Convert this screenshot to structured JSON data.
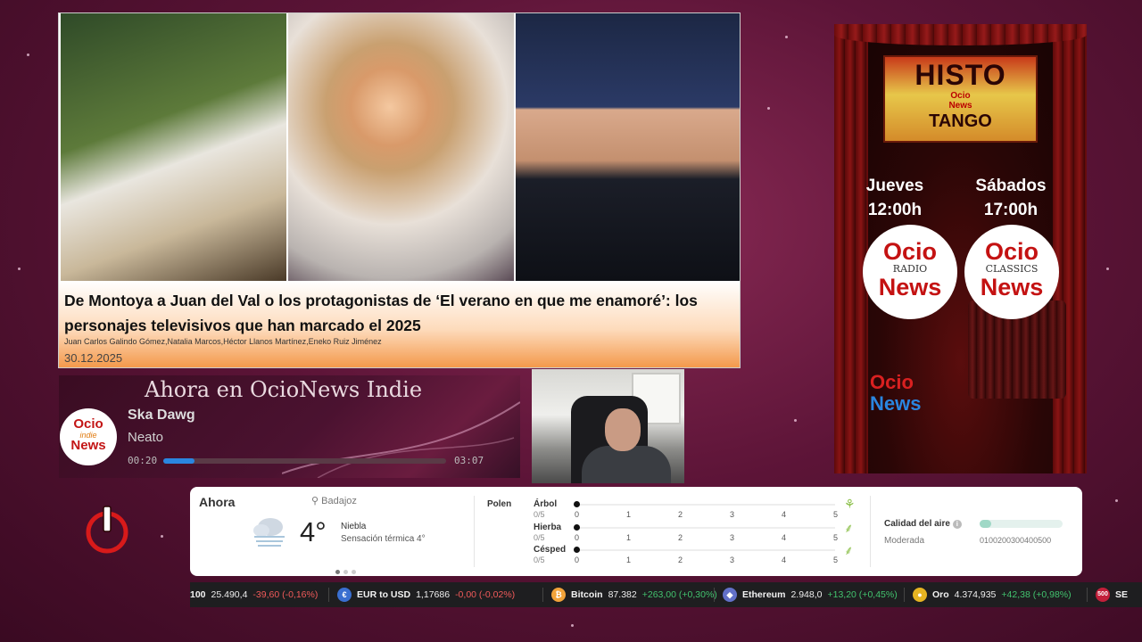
{
  "hero": {
    "title": "De Montoya a Juan del Val o los protagonistas de ‘El verano en que me enamoré’: los personajes televisivos que han marcado el 2025",
    "authors": "Juan Carlos Galindo Gómez,Natalia Marcos,Héctor Llanos Martínez,Eneko Ruiz Jiménez",
    "date": "30.12.2025"
  },
  "radio": {
    "heading": "Ahora en OcioNews Indie",
    "logo_top": "Ocio",
    "logo_mid": "indie",
    "logo_bottom": "News",
    "song": "Ska Dawg",
    "artist": "Neato",
    "elapsed": "00:20",
    "duration": "03:07",
    "progress_fraction": 0.11
  },
  "poster": {
    "histo_title": "HISTO",
    "histo_brand_1": "Ocio",
    "histo_brand_2": "News",
    "histo_sub": "TANGO",
    "day1": "Jueves",
    "time1": "12:00h",
    "day2": "Sábados",
    "time2": "17:00h",
    "badge1_top": "Ocio",
    "badge1_mid": "RADIO",
    "badge1_bottom": "News",
    "badge2_top": "Ocio",
    "badge2_mid": "CLASSICS",
    "badge2_bottom": "News",
    "logo_top": "Ocio",
    "logo_bottom": "News"
  },
  "weather": {
    "now_label": "Ahora",
    "location": "Badajoz",
    "temperature": "4°",
    "condition": "Niebla",
    "feels_like": "Sensación térmica 4°",
    "icon": "fog-cloud-icon",
    "pollen_title": "Polen",
    "pollen": [
      {
        "label": "Árbol",
        "score": "0/5",
        "icon": "tree-icon"
      },
      {
        "label": "Hierba",
        "score": "0/5",
        "icon": "herb-icon"
      },
      {
        "label": "Césped",
        "score": "0/5",
        "icon": "grass-icon"
      }
    ],
    "pollen_ticks": [
      "0",
      "1",
      "2",
      "3",
      "4",
      "5"
    ],
    "air_quality_label": "Calidad del aire",
    "air_quality_status": "Moderada",
    "air_quality_scale": "0100200300400500",
    "air_quality_fraction": 0.14
  },
  "ticker": {
    "items": [
      {
        "name": "100",
        "value": "25.490,4",
        "change": "-39,60 (-0,16%)",
        "dir": "neg",
        "icon": ""
      },
      {
        "name": "EUR to USD",
        "value": "1,17686",
        "change": "-0,00 (-0,02%)",
        "dir": "neg",
        "icon": "currency-icon"
      },
      {
        "name": "Bitcoin",
        "value": "87.382",
        "change": "+263,00 (+0,30%)",
        "dir": "pos",
        "icon": "bitcoin-icon"
      },
      {
        "name": "Ethereum",
        "value": "2.948,0",
        "change": "+13,20 (+0,45%)",
        "dir": "pos",
        "icon": "ethereum-icon"
      },
      {
        "name": "Oro",
        "value": "4.374,935",
        "change": "+42,38 (+0,98%)",
        "dir": "pos",
        "icon": "gold-icon"
      },
      {
        "name": "SE",
        "value": "",
        "change": "",
        "dir": "",
        "icon": "sp500-icon",
        "badge": "500"
      }
    ]
  },
  "colors": {
    "background": "#5c1437",
    "brand_red": "#c41212",
    "brand_blue": "#2a86e0",
    "positive": "#42c36e",
    "negative": "#f05a5a"
  }
}
